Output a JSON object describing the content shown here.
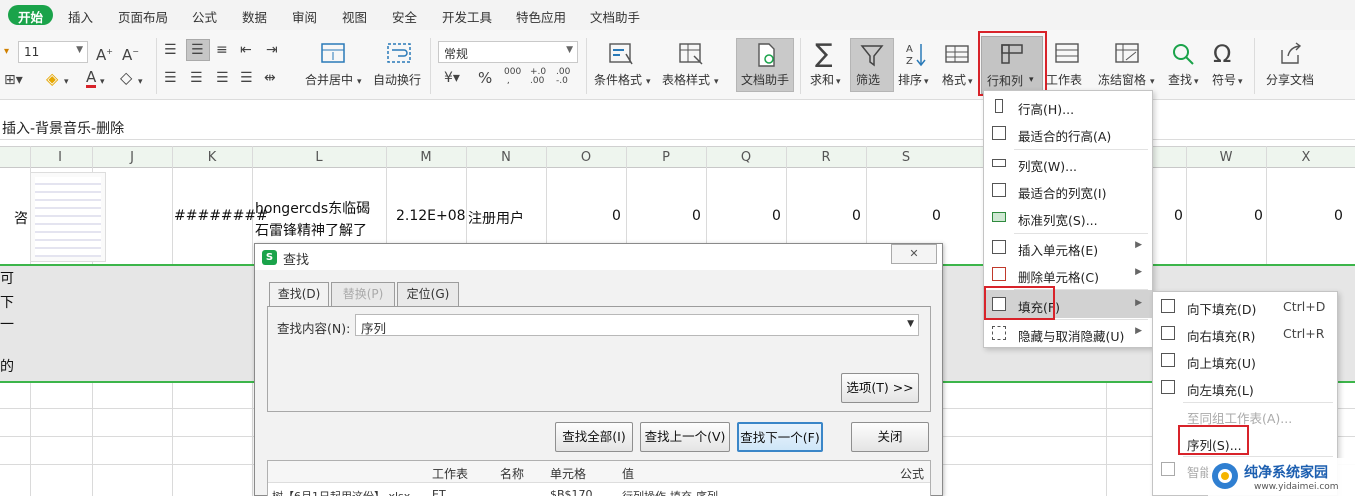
{
  "tabs": [
    "开始",
    "插入",
    "页面布局",
    "公式",
    "数据",
    "审阅",
    "视图",
    "安全",
    "开发工具",
    "特色应用",
    "文档助手"
  ],
  "ribbon": {
    "font_size": "11",
    "number_format": "常规",
    "merge_label": "合并居中",
    "wrap_label": "自动换行",
    "cond_format_label": "条件格式",
    "table_style_label": "表格样式",
    "doc_assist_label": "文档助手",
    "sum_label": "求和",
    "filter_label": "筛选",
    "sort_label": "排序",
    "format_label": "格式",
    "rowcol_label": "行和列",
    "sheet_label": "工作表",
    "freeze_label": "冻结窗格",
    "find_label": "查找",
    "symbol_label": "符号",
    "share_label": "分享文档"
  },
  "formula_bar": {
    "content": "插入-背景音乐-删除"
  },
  "columns": [
    "I",
    "J",
    "K",
    "L",
    "M",
    "N",
    "O",
    "P",
    "Q",
    "R",
    "S",
    "W",
    "X"
  ],
  "row1": {
    "h_partial": "咨",
    "k": "########",
    "l_line1": "hongercds东临碣",
    "l_line2": "石雷锋精神了解了",
    "m": "2.12E+08",
    "n": "注册用户",
    "zeros": [
      "0",
      "0",
      "0",
      "0",
      "0",
      "0",
      "0",
      "0"
    ]
  },
  "row2_left_chars": [
    "可",
    "下",
    "一",
    "的"
  ],
  "find_dialog": {
    "title": "查找",
    "tab_find": "查找(D)",
    "tab_replace": "替换(P)",
    "tab_goto": "定位(G)",
    "field_label": "查找内容(N):",
    "field_value": "序列",
    "options_btn": "选项(T) >>",
    "btn_find_all": "查找全部(I)",
    "btn_find_prev": "查找上一个(V)",
    "btn_find_next": "查找下一个(F)",
    "btn_close": "关闭",
    "results_headers": [
      "工作表",
      "名称",
      "单元格",
      "值",
      "公式"
    ],
    "results_row": {
      "book": "树【6月1日起用这份】.xlsx",
      "sheet": "ET",
      "cell": "$B$170",
      "value": "行列操作-填充-序列"
    }
  },
  "rowcol_menu": {
    "items": [
      {
        "label": "行高(H)...",
        "icon": "row-height-icon"
      },
      {
        "label": "最适合的行高(A)",
        "icon": "autofit-row-icon"
      },
      {
        "label": "列宽(W)...",
        "icon": "column-width-icon"
      },
      {
        "label": "最适合的列宽(I)",
        "icon": "autofit-column-icon"
      },
      {
        "label": "标准列宽(S)...",
        "icon": "standard-width-icon"
      },
      {
        "label": "插入单元格(E)",
        "icon": "insert-cells-icon"
      },
      {
        "label": "删除单元格(C)",
        "icon": "delete-cells-icon"
      },
      {
        "label": "填充(F)",
        "icon": "fill-icon"
      },
      {
        "label": "隐藏与取消隐藏(U)",
        "icon": "hide-unhide-icon"
      }
    ]
  },
  "fill_menu": {
    "items": [
      {
        "label": "向下填充(D)",
        "key": "Ctrl+D"
      },
      {
        "label": "向右填充(R)",
        "key": "Ctrl+R"
      },
      {
        "label": "向上填充(U)",
        "key": ""
      },
      {
        "label": "向左填充(L)",
        "key": ""
      },
      {
        "label": "至同组工作表(A)...",
        "key": ""
      },
      {
        "label": "序列(S)...",
        "key": ""
      },
      {
        "label": "智能",
        "key": ""
      }
    ]
  },
  "watermark": {
    "brand": "纯净系统家园",
    "url": "www.yidaimei.com"
  },
  "colors": {
    "accent_green": "#1aa34a",
    "highlight_red": "#d8232a",
    "grid_green": "#3cb54a"
  }
}
